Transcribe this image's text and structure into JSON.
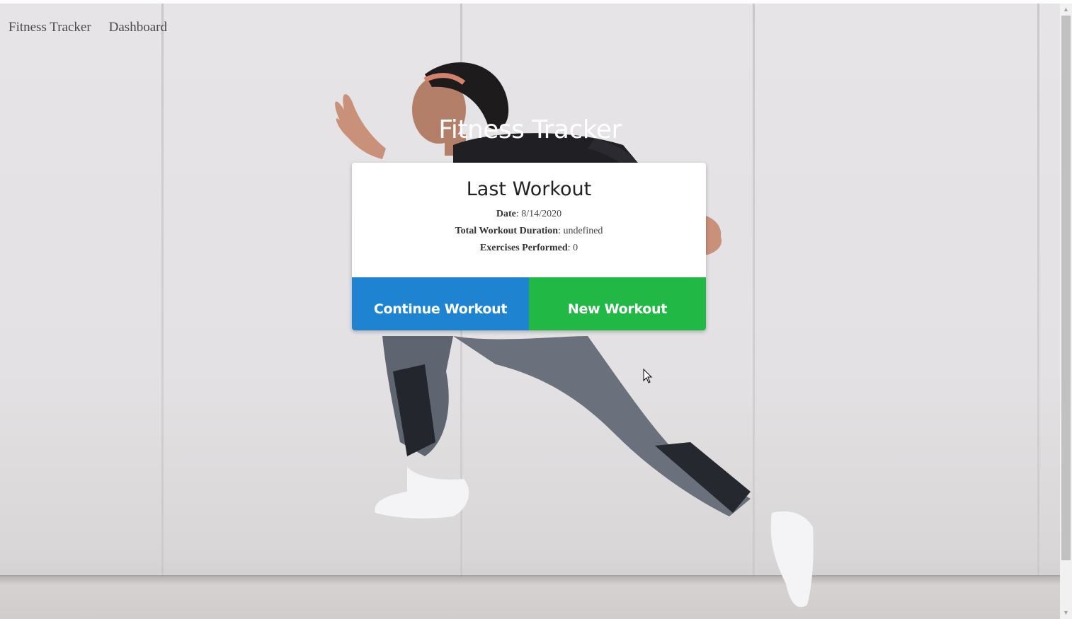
{
  "nav": {
    "brand": "Fitness Tracker",
    "dashboard": "Dashboard"
  },
  "hero": {
    "title": "Fitness Tracker"
  },
  "card": {
    "title": "Last Workout",
    "stats": [
      {
        "label": "Date",
        "value": "8/14/2020"
      },
      {
        "label": "Total Workout Duration",
        "value": "undefined"
      },
      {
        "label": "Exercises Performed",
        "value": "0"
      }
    ],
    "continue_label": "Continue Workout",
    "new_label": "New Workout"
  },
  "colors": {
    "continue": "#1e84d2",
    "new": "#22b846"
  },
  "icons": {
    "cursor": "arrow-cursor-icon",
    "scroll_up": "scroll-up-icon",
    "scroll_down": "scroll-down-icon"
  }
}
